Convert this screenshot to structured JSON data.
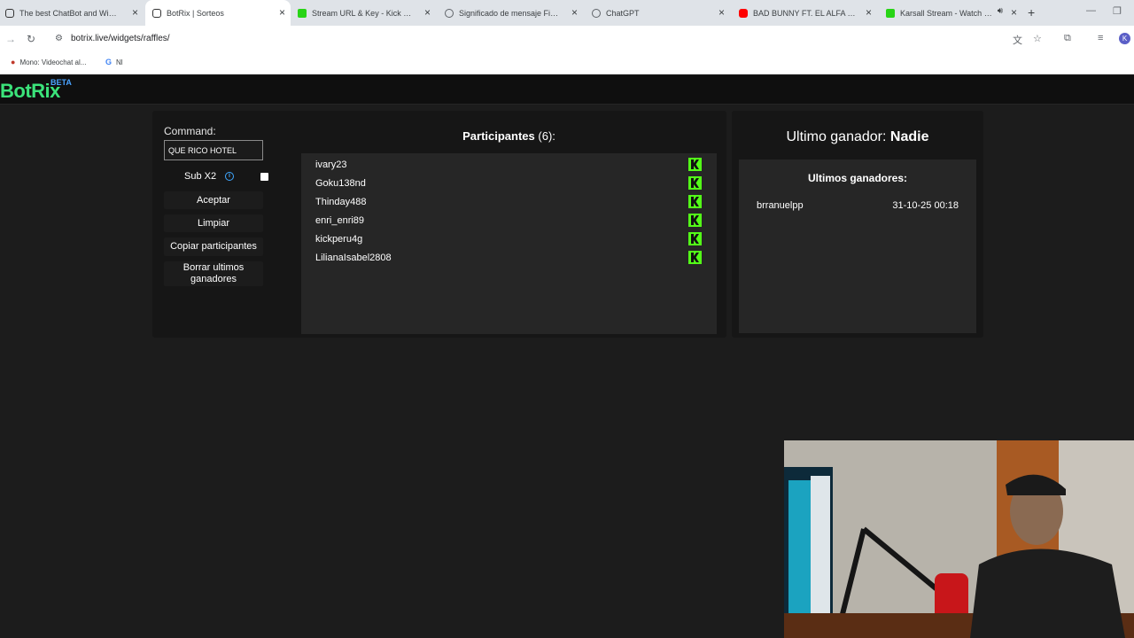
{
  "browser": {
    "tabs": [
      {
        "title": "The best ChatBot and Widgets",
        "favicon": "botrix-icon",
        "active": false
      },
      {
        "title": "BotRix | Sorteos",
        "favicon": "botrix-icon",
        "active": true
      },
      {
        "title": "Stream URL & Key - Kick Dashb",
        "favicon": "kick-icon",
        "active": false
      },
      {
        "title": "Significado de mensaje FiveM",
        "favicon": "globe-icon",
        "active": false
      },
      {
        "title": "ChatGPT",
        "favicon": "globe-icon",
        "active": false
      },
      {
        "title": "BAD BUNNY FT. EL ALFA - LA R",
        "favicon": "youtube-icon",
        "active": false
      },
      {
        "title": "Karsall Stream - Watch Live",
        "favicon": "kick-icon",
        "active": false
      }
    ],
    "url": "botrix.live/widgets/raffles/",
    "profile_initial": "K",
    "bookmarks": [
      {
        "label": "Mono: Videochat al...",
        "icon": "mono-icon"
      },
      {
        "label": "Nl",
        "icon": "google-icon"
      }
    ]
  },
  "header": {
    "logo": "BotRix",
    "badge": "BETA"
  },
  "raffle": {
    "command_label": "Command:",
    "command_value": "QUE RICO HOTEL",
    "sub_label": "Sub X2",
    "buttons": {
      "accept": "Aceptar",
      "clear": "Limpiar",
      "copy": "Copiar participantes",
      "delete_winners": "Borrar ultimos ganadores"
    }
  },
  "participants": {
    "title": "Participantes",
    "count": "(6):",
    "list": [
      {
        "name": "ivary23",
        "platform": "kick-icon"
      },
      {
        "name": "Goku138nd",
        "platform": "kick-icon"
      },
      {
        "name": "Thinday488",
        "platform": "kick-icon"
      },
      {
        "name": "enri_enri89",
        "platform": "kick-icon"
      },
      {
        "name": "kickperu4g",
        "platform": "kick-icon"
      },
      {
        "name": "LilianaIsabel2808",
        "platform": "kick-icon"
      }
    ]
  },
  "winners": {
    "last_label": "Ultimo ganador:",
    "last_value": "Nadie",
    "heading": "Ultimos ganadores:",
    "list": [
      {
        "name": "brranuelpp",
        "date": "31-10-25 00:18"
      }
    ]
  },
  "colors": {
    "accent": "#53fc18",
    "logo": "#3be37a",
    "beta": "#4aa3ff",
    "background": "#1c1c1c",
    "panel": "#262626"
  }
}
